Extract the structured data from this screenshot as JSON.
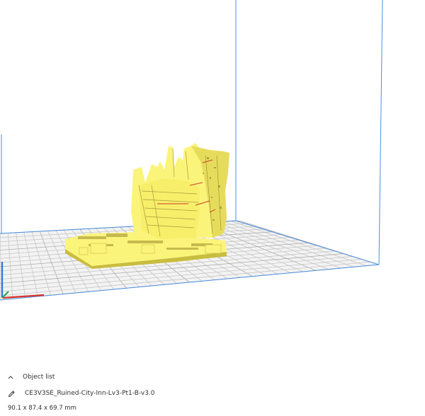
{
  "object_list": {
    "toggle_icon": "chevron-up-icon",
    "label": "Object list"
  },
  "object": {
    "edit_icon": "pencil-icon",
    "name": "CE3V3SE_Ruined-City-Inn-Lv3-Pt1-B-v3.0",
    "dimensions": "90.1 x 87.4 x 69.7 mm"
  },
  "colors": {
    "model": "#fbf47a",
    "model_shadow": "#c9bd3e",
    "model_dark": "#8c7e2a",
    "model_red": "#d2432c",
    "build_volume_edge": "#4a8fe0",
    "grid_line": "#c3c3c3",
    "grid_major": "#a9a9a9",
    "plate": "#f3f3f3",
    "axis_x": "#d9312b",
    "axis_y": "#2f6fd8",
    "axis_z": "#2aa84a"
  }
}
